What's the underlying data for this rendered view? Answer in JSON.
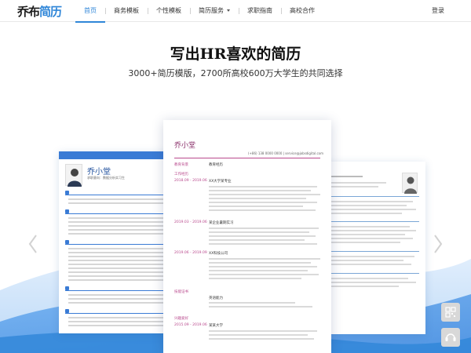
{
  "brand": {
    "part1": "乔布",
    "part2": "简历"
  },
  "nav": {
    "items": [
      {
        "label": "首页",
        "active": true
      },
      {
        "label": "商务模板",
        "active": false
      },
      {
        "label": "个性模板",
        "active": false
      },
      {
        "label": "简历服务",
        "active": false,
        "has_dropdown": true
      },
      {
        "label": "求职指南",
        "active": false
      },
      {
        "label": "高校合作",
        "active": false
      }
    ],
    "login": "登录"
  },
  "hero": {
    "title": "写出HR喜欢的简历",
    "subtitle": "3000+简历模版，2700所高校600万大学生的共同选择"
  },
  "showcase": {
    "left_card": {
      "name": "乔小堂",
      "subtitle": "求职意向：数据分析实习生"
    },
    "center_card": {
      "name": "乔小堂",
      "contact": "(+86) 138 0000 0000   |   service@jobsdigital.com",
      "rows": [
        {
          "label": "教育背景",
          "text": "教育经历"
        },
        {
          "label": "工作经历",
          "text": ""
        },
        {
          "label": "2018.09 - 2019.06",
          "text": "XX大学某专业"
        },
        {
          "label": "2019.03 - 2019.06",
          "text": "某企业暑期实习"
        },
        {
          "label": "2019.06 - 2019.09",
          "text": "XX科技公司"
        },
        {
          "label": "技能证书",
          "text": "英语能力"
        },
        {
          "label": "兴趣爱好",
          "text": ""
        },
        {
          "label": "2015.09 - 2019.06",
          "text": "某某大学"
        }
      ]
    }
  },
  "colors": {
    "brand_blue": "#2f86d8",
    "center_accent": "#b9498d",
    "left_accent": "#3a7bd5"
  },
  "icons": {
    "arrow_left": "chevron-left-icon",
    "arrow_right": "chevron-right-icon",
    "qr": "qr-code-icon",
    "service": "customer-service-icon"
  }
}
